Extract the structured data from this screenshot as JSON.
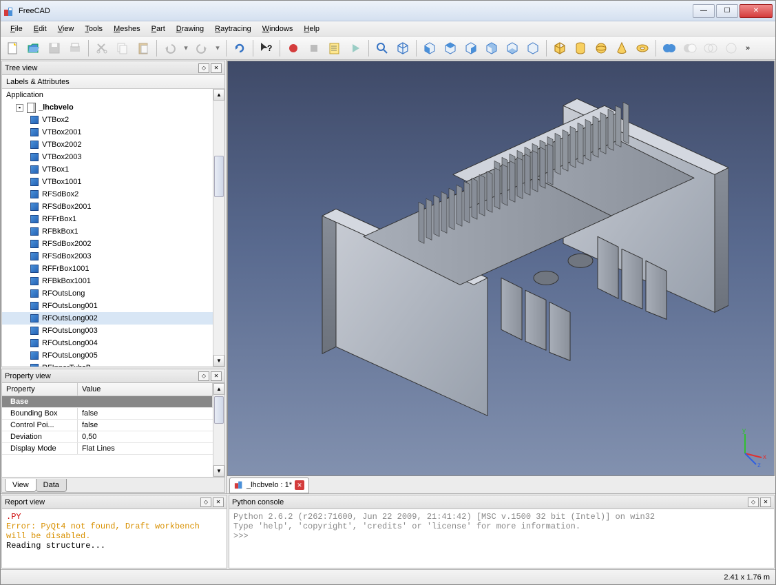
{
  "window": {
    "title": "FreeCAD"
  },
  "menu": [
    "File",
    "Edit",
    "View",
    "Tools",
    "Meshes",
    "Part",
    "Drawing",
    "Raytracing",
    "Windows",
    "Help"
  ],
  "docks": {
    "tree": {
      "title": "Tree view",
      "subheader": "Labels & Attributes",
      "root": "Application"
    },
    "prop": {
      "title": "Property view",
      "headers": [
        "Property",
        "Value"
      ]
    },
    "report": {
      "title": "Report view"
    },
    "pycon": {
      "title": "Python console"
    }
  },
  "document": {
    "name": "_lhcbvelo",
    "tab": "_lhcbvelo : 1*"
  },
  "tree_items": [
    "VTBox2",
    "VTBox2001",
    "VTBox2002",
    "VTBox2003",
    "VTBox1",
    "VTBox1001",
    "RFSdBox2",
    "RFSdBox2001",
    "RFFrBox1",
    "RFBkBox1",
    "RFSdBox2002",
    "RFSdBox2003",
    "RFFrBox1001",
    "RFBkBox1001",
    "RFOutsLong",
    "RFOutsLong001",
    "RFOutsLong002",
    "RFOutsLong003",
    "RFOutsLong004",
    "RFOutsLong005",
    "RFInnerTubsB"
  ],
  "tree_selected": "RFOutsLong002",
  "props": {
    "group": "Base",
    "rows": [
      {
        "name": "Bounding Box",
        "value": "false"
      },
      {
        "name": "Control Poi...",
        "value": "false"
      },
      {
        "name": "Deviation",
        "value": "0,50"
      },
      {
        "name": "Display Mode",
        "value": "Flat Lines"
      }
    ],
    "tabs": [
      "View",
      "Data"
    ],
    "active_tab": "View"
  },
  "report_lines": [
    {
      "text": ".PY",
      "color": "#c00"
    },
    {
      "text": "Error: PyQt4 not found, Draft workbench will be disabled.",
      "color": "#d89000"
    },
    {
      "text": "Reading structure...",
      "color": "#000"
    }
  ],
  "python_lines": [
    "Python 2.6.2 (r262:71600, Jun 22 2009, 21:41:42) [MSC v.1500 32 bit (Intel)] on win32",
    "Type 'help', 'copyright', 'credits' or 'license' for more information.",
    ">>> "
  ],
  "status": {
    "dimensions": "2.41 x 1.76 m"
  },
  "axis_labels": {
    "x": "x",
    "y": "y",
    "z": "z"
  }
}
